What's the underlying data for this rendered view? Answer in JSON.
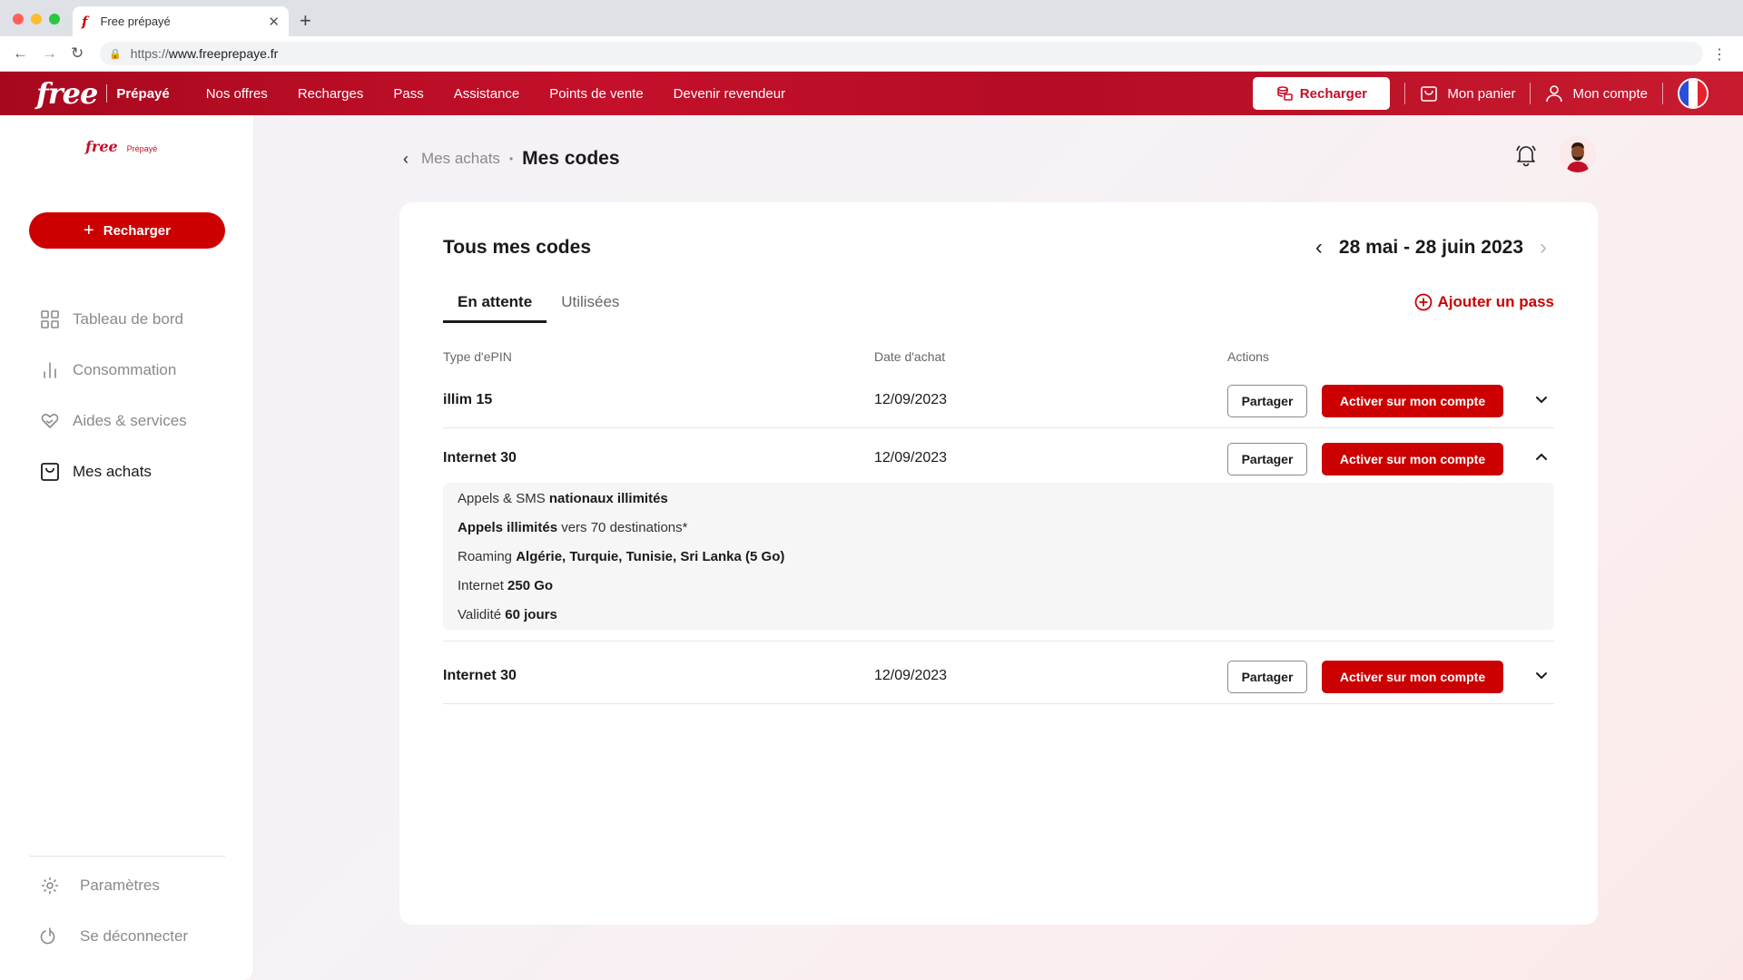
{
  "browser": {
    "tab_title": "Free prépayé",
    "url_scheme": "https://",
    "url_host": "www.freeprepaye.fr"
  },
  "header": {
    "brand": "free",
    "brand_sub": "Prépayé",
    "nav": [
      "Nos offres",
      "Recharges",
      "Pass",
      "Assistance",
      "Points de vente",
      "Devenir revendeur"
    ],
    "recharge_label": "Recharger",
    "cart_label": "Mon panier",
    "account_label": "Mon compte"
  },
  "sidebar": {
    "brand": "free",
    "brand_sub": "Prépayé",
    "recharge_label": "Recharger",
    "items": [
      {
        "label": "Tableau de bord",
        "icon": "grid-icon"
      },
      {
        "label": "Consommation",
        "icon": "bar-chart-icon"
      },
      {
        "label": "Aides & services",
        "icon": "heart-hand-icon"
      },
      {
        "label": "Mes achats",
        "icon": "shopping-bag-icon",
        "active": true
      }
    ],
    "footer": [
      {
        "label": "Paramètres",
        "icon": "gear-icon"
      },
      {
        "label": "Se déconnecter",
        "icon": "power-icon"
      }
    ]
  },
  "breadcrumb": {
    "parent": "Mes achats",
    "current": "Mes codes"
  },
  "main": {
    "title": "Tous mes codes",
    "date_range": "28 mai - 28 juin 2023",
    "tabs": [
      "En attente",
      "Utilisées"
    ],
    "add_pass": "Ajouter un pass",
    "columns": [
      "Type d'ePIN",
      "Date d'achat",
      "Actions"
    ],
    "share_label": "Partager",
    "activate_label": "Activer sur mon compte",
    "rows": [
      {
        "type": "illim 15",
        "date": "12/09/2023",
        "expanded": false
      },
      {
        "type": "Internet 30",
        "date": "12/09/2023",
        "expanded": true
      },
      {
        "type": "Internet 30",
        "date": "12/09/2023",
        "expanded": false
      }
    ],
    "details": [
      {
        "pre": "Appels & SMS ",
        "bold": "nationaux illimités",
        "post": ""
      },
      {
        "pre": "",
        "bold": "Appels illimités",
        "post": " vers 70 destinations*"
      },
      {
        "pre": "Roaming ",
        "bold": "Algérie, Turquie, Tunisie, Sri Lanka (5 Go)",
        "post": ""
      },
      {
        "pre": "Internet ",
        "bold": "250 Go",
        "post": ""
      },
      {
        "pre": "Validité ",
        "bold": "60 jours",
        "post": ""
      }
    ]
  },
  "colors": {
    "brand_red": "#cc0000",
    "header_red": "#b50c24"
  }
}
